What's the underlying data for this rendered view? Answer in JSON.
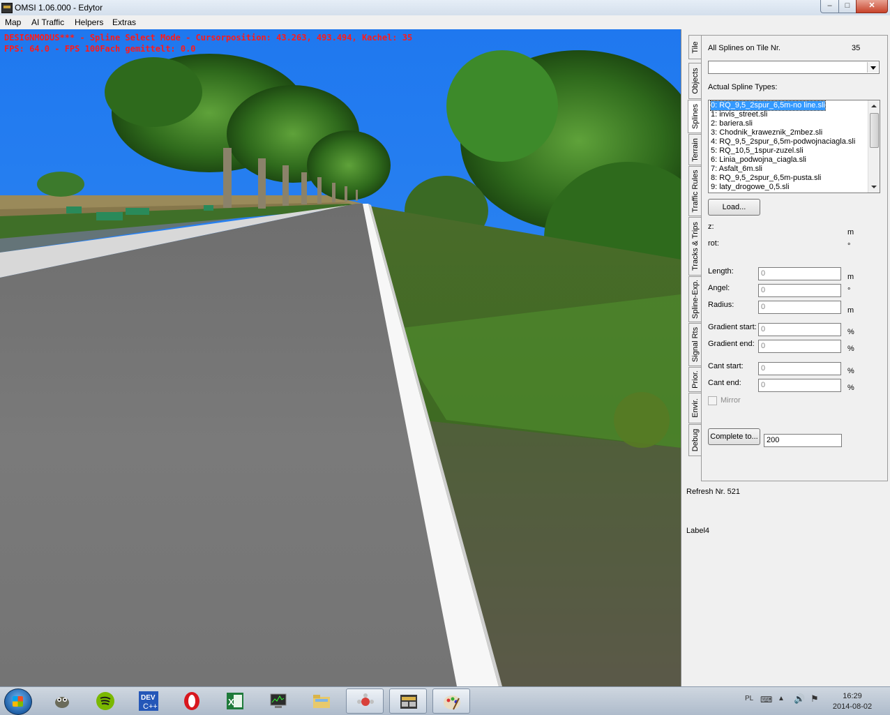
{
  "window": {
    "title": "OMSI 1.06.000 - Edytor",
    "minimize_glyph": "–",
    "maximize_glyph": "□",
    "close_glyph": "✕"
  },
  "menu": [
    "Map",
    "AI Traffic",
    "Helpers",
    "Extras"
  ],
  "hud": {
    "line1": "DESIGNMODUS*** - Spline Select Mode - Cursorposition: 43.263, 493.494, Kachel: 35",
    "line2": "FPS: 64.0 - FPS 100Fach gemittelt: 0.0"
  },
  "tabs": [
    "Tile",
    "Objects",
    "Splines",
    "Terrain",
    "Traffic Rules",
    "Tracks & Trips",
    "Spline-Exp.",
    "Signal Rts",
    "Prior.",
    "Envir.",
    "Debug"
  ],
  "active_tab": "Splines",
  "splines": {
    "all_label": "All Splines on Tile Nr.",
    "tile_number": "35",
    "combo_value": "",
    "actual_types_label": "Actual Spline Types:",
    "types": [
      "0: RQ_9,5_2spur_6,5m-no line.sli",
      "1: invis_street.sli",
      "2: bariera.sli",
      "3: Chodnik_kraweznik_2mbez.sli",
      "4: RQ_9,5_2spur_6,5m-podwojnaciagla.sli",
      "5: RQ_10,5_1spur-zuzel.sli",
      "6: Linia_podwojna_ciagla.sli",
      "7: Asfalt_6m.sli",
      "8: RQ_9,5_2spur_6,5m-pusta.sli",
      "9: laty_drogowe_0,5.sli"
    ],
    "selected_index": 0,
    "load_button": "Load...",
    "z_label": "z:",
    "z_unit": "m",
    "rot_label": "rot:",
    "rot_unit": "°",
    "length": {
      "label": "Length:",
      "value": "0",
      "unit": "m"
    },
    "angel": {
      "label": "Angel:",
      "value": "0",
      "unit": "°"
    },
    "radius": {
      "label": "Radius:",
      "value": "0",
      "unit": "m"
    },
    "gradient_start": {
      "label": "Gradient start:",
      "value": "0",
      "unit": "%"
    },
    "gradient_end": {
      "label": "Gradient end:",
      "value": "0",
      "unit": "%"
    },
    "cant_start": {
      "label": "Cant start:",
      "value": "0",
      "unit": "%"
    },
    "cant_end": {
      "label": "Cant end:",
      "value": "0",
      "unit": "%"
    },
    "mirror_label": "Mirror",
    "mirror_checked": false,
    "complete_button": "Complete to...",
    "complete_value": "200"
  },
  "refresh_label": "Refresh Nr. 521",
  "label4": "Label4",
  "taskbar": {
    "apps": [
      "start-button",
      "gimp-icon",
      "spotify-icon",
      "devcpp-icon",
      "opera-icon",
      "excel-icon",
      "task-manager-icon",
      "file-explorer-icon",
      "network-tool-icon",
      "omsi-icon",
      "paint-icon"
    ],
    "language": "PL",
    "time": "16:29",
    "date": "2014-08-02"
  },
  "colors": {
    "hud_text": "#ff1a1a",
    "sky": "#2a82f2",
    "selection": "#3399ff"
  }
}
